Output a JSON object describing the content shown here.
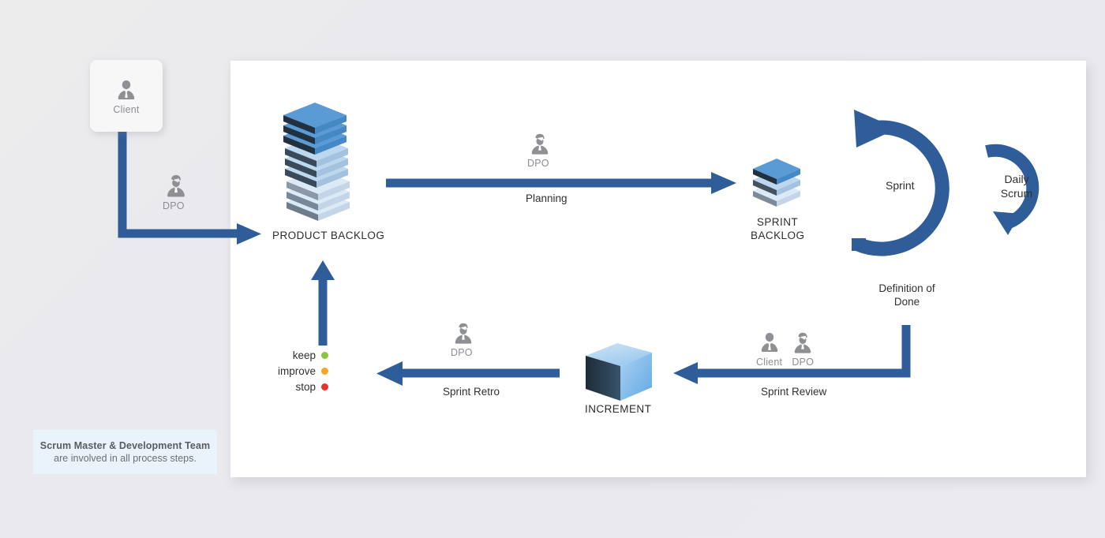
{
  "colors": {
    "arrow_blue": "#2f5d99",
    "accent_blue": "#3a6cab",
    "panel_bg": "#ffffff",
    "page_bg": "#ebebef",
    "note_bg": "#eaf3fb",
    "icon_gray": "#8e9094",
    "label_dark": "#2f3033",
    "keep_green": "#8cc63f",
    "improve_orange": "#f5a623",
    "stop_red": "#e8332a",
    "backlog_blue_top": "#5b9bd5",
    "backlog_blue_mid": "#bdd7ee",
    "backlog_blue_light": "#dce9f6",
    "backlog_dark": "#2b3a47"
  },
  "client_card": {
    "label": "Client",
    "icon": "person-client-icon"
  },
  "roles": {
    "dpo_backlog": {
      "label": "DPO",
      "icon": "person-dpo-icon"
    },
    "dpo_planning": {
      "label": "DPO",
      "icon": "person-dpo-icon"
    },
    "dpo_retro": {
      "label": "DPO",
      "icon": "person-dpo-icon"
    },
    "review_client": {
      "label": "Client",
      "icon": "person-client-icon"
    },
    "review_dpo": {
      "label": "DPO",
      "icon": "person-dpo-icon"
    }
  },
  "artifacts": {
    "product_backlog": {
      "label": "PRODUCT BACKLOG",
      "icon": "stacked-layers-icon"
    },
    "sprint_backlog": {
      "line1": "SPRINT",
      "line2": "BACKLOG",
      "icon": "stacked-layers-small-icon"
    },
    "increment": {
      "label": "INCREMENT",
      "icon": "cube-icon"
    }
  },
  "cycle": {
    "sprint_label": "Sprint",
    "daily_scrum_line1": "Daily",
    "daily_scrum_line2": "Scrum",
    "definition_of_done_line1": "Definition of",
    "definition_of_done_line2": "Done"
  },
  "flow_labels": {
    "planning": "Planning",
    "sprint_retro": "Sprint Retro",
    "sprint_review": "Sprint Review"
  },
  "retro_legend": [
    {
      "text": "keep",
      "color": "#8cc63f"
    },
    {
      "text": "improve",
      "color": "#f5a623"
    },
    {
      "text": "stop",
      "color": "#e8332a"
    }
  ],
  "footnote": {
    "line1": "Scrum Master & Development Team",
    "line2": "are involved in all process steps."
  }
}
